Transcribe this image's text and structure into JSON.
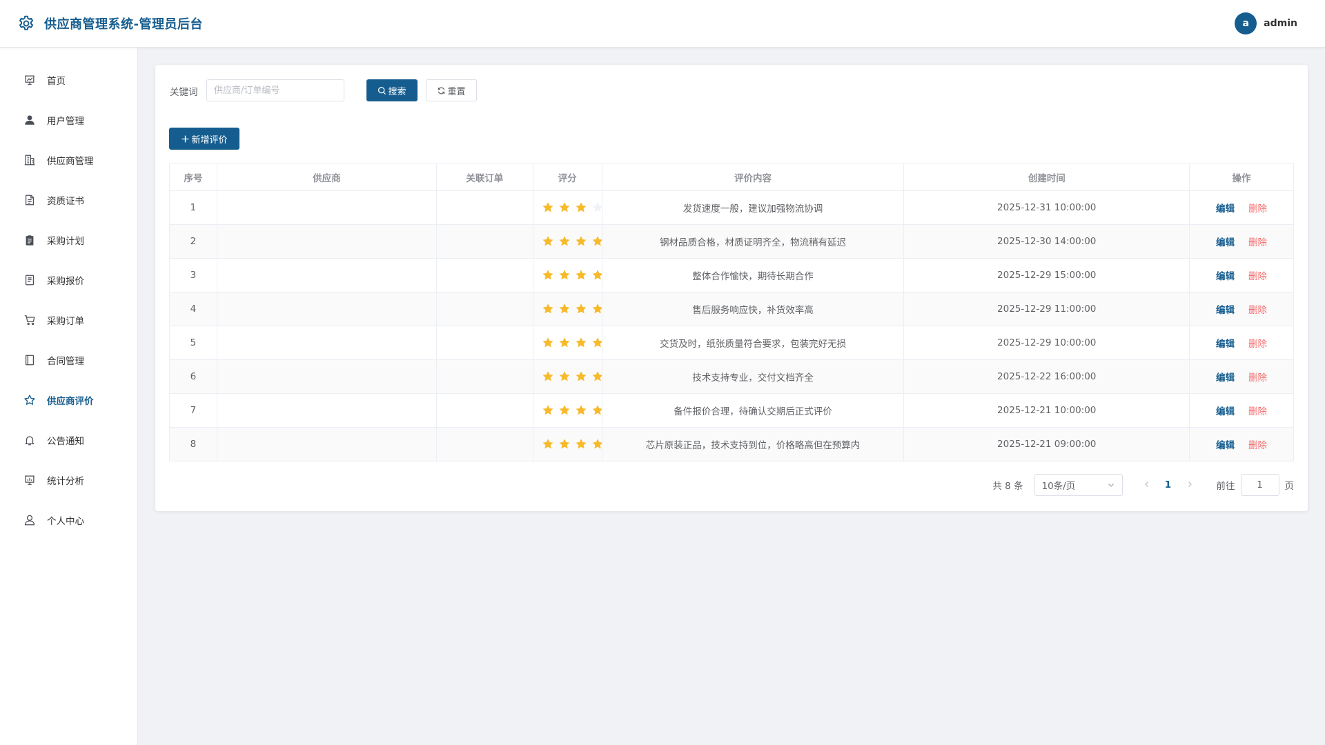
{
  "app": {
    "title": "供应商管理系统-管理员后台",
    "brand_color": "#165D8F",
    "user": {
      "avatar_letter": "a",
      "name": "admin"
    }
  },
  "sidebar": {
    "items": [
      {
        "label": "首页",
        "icon": "dashboard-icon"
      },
      {
        "label": "用户管理",
        "icon": "user-icon"
      },
      {
        "label": "供应商管理",
        "icon": "building-icon"
      },
      {
        "label": "资质证书",
        "icon": "document-icon"
      },
      {
        "label": "采购计划",
        "icon": "clipboard-icon"
      },
      {
        "label": "采购报价",
        "icon": "tickets-icon"
      },
      {
        "label": "采购订单",
        "icon": "cart-icon"
      },
      {
        "label": "合同管理",
        "icon": "notebook-icon"
      },
      {
        "label": "供应商评价",
        "icon": "star-icon",
        "active": true
      },
      {
        "label": "公告通知",
        "icon": "bell-icon"
      },
      {
        "label": "统计分析",
        "icon": "data-board-icon"
      },
      {
        "label": "个人中心",
        "icon": "user-outline-icon"
      }
    ]
  },
  "filter": {
    "keyword_label": "关键词",
    "keyword_value": "",
    "keyword_placeholder": "供应商/订单编号",
    "search_label": "搜索",
    "reset_label": "重置",
    "add_label": "新增评价"
  },
  "table": {
    "columns": [
      "序号",
      "供应商",
      "关联订单",
      "评分",
      "评价内容",
      "创建时间",
      "操作"
    ],
    "edit_label": "编辑",
    "delete_label": "删除",
    "star_color": "#F7BA2A",
    "star_empty_color": "#EFF2F7",
    "rows": [
      {
        "no": "1",
        "supplier": "",
        "order": "",
        "score": 3,
        "content": "发货速度一般，建议加强物流协调",
        "created": "2025-12-31 10:00:00"
      },
      {
        "no": "2",
        "supplier": "",
        "order": "",
        "score": 4,
        "content": "钢材品质合格，材质证明齐全，物流稍有延迟",
        "created": "2025-12-30 14:00:00"
      },
      {
        "no": "3",
        "supplier": "",
        "order": "",
        "score": 4,
        "content": "整体合作愉快，期待长期合作",
        "created": "2025-12-29 15:00:00"
      },
      {
        "no": "4",
        "supplier": "",
        "order": "",
        "score": 4,
        "content": "售后服务响应快，补货效率高",
        "created": "2025-12-29 11:00:00"
      },
      {
        "no": "5",
        "supplier": "",
        "order": "",
        "score": 4,
        "content": "交货及时，纸张质量符合要求，包装完好无损",
        "created": "2025-12-29 10:00:00"
      },
      {
        "no": "6",
        "supplier": "",
        "order": "",
        "score": 4,
        "content": "技术支持专业，交付文档齐全",
        "created": "2025-12-22 16:00:00"
      },
      {
        "no": "7",
        "supplier": "",
        "order": "",
        "score": 4,
        "content": "备件报价合理，待确认交期后正式评价",
        "created": "2025-12-21 10:00:00"
      },
      {
        "no": "8",
        "supplier": "",
        "order": "",
        "score": 4,
        "content": "芯片原装正品，技术支持到位，价格略高但在预算内",
        "created": "2025-12-21 09:00:00"
      }
    ]
  },
  "pagination": {
    "total_text": "共 8 条",
    "page_size": "10条/页",
    "current_page": "1",
    "goto_label": "前往",
    "goto_value": "1",
    "goto_suffix": "页"
  }
}
